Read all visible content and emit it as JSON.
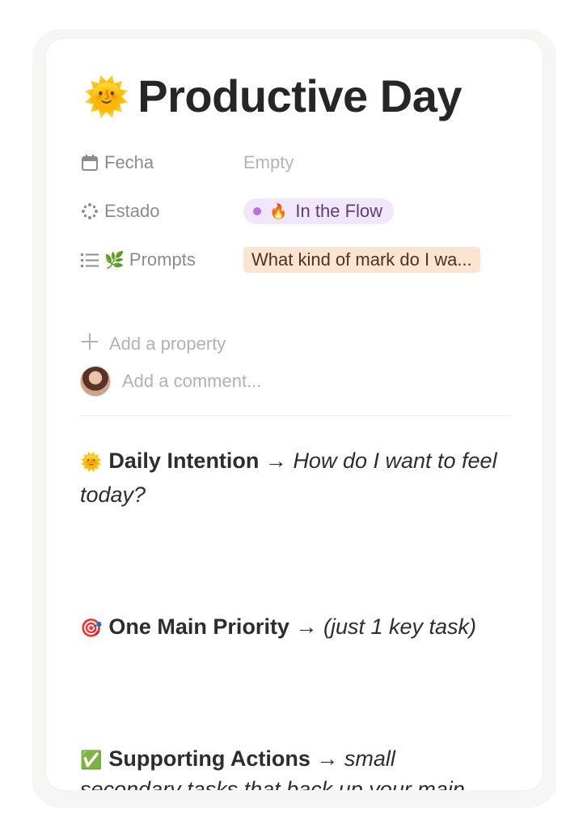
{
  "page": {
    "title_emoji": "🌞",
    "title": "Productive Day"
  },
  "properties": [
    {
      "label": "Fecha",
      "icon": "calendar-icon",
      "value": "Empty",
      "value_type": "empty"
    },
    {
      "label": "Estado",
      "icon": "status-spinner-icon",
      "value": "In the Flow",
      "value_emoji": "🔥",
      "value_type": "status",
      "status_color": "#b970e0"
    },
    {
      "label": "Prompts",
      "label_emoji": "🌿",
      "icon": "list-icon",
      "value": "What kind of mark do I wa...",
      "value_type": "relation"
    }
  ],
  "add_property": {
    "label": "Add a property",
    "icon": "plus-icon"
  },
  "comment": {
    "placeholder": "Add a comment..."
  },
  "blocks": [
    {
      "emoji": "🌞",
      "bold": "Daily Intention",
      "arrow": " → ",
      "italic": "How do I want to feel today?"
    },
    {
      "emoji": "🎯",
      "bold": "One Main Priority",
      "arrow": " → ",
      "italic": "(just 1 key task)"
    },
    {
      "emoji": "✅",
      "bold": "Supporting Actions",
      "arrow": " → ",
      "italic": "small"
    }
  ],
  "cutoff_text": "secondary tasks that back up your main"
}
